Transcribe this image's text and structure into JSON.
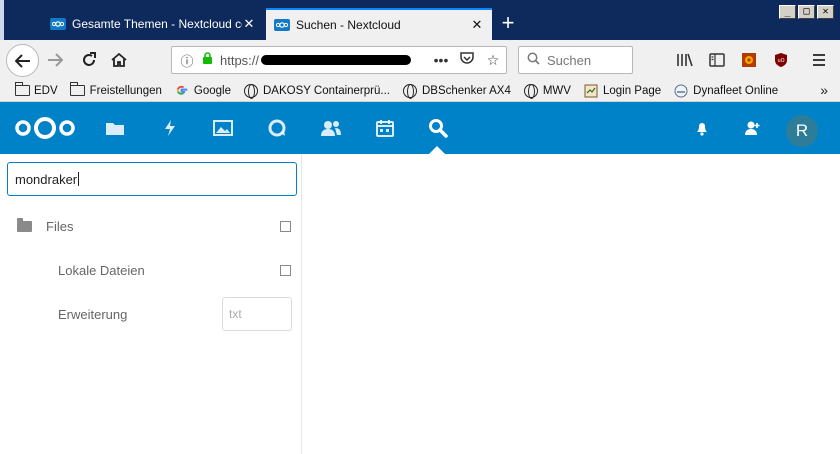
{
  "browser": {
    "tabs": [
      {
        "title": "Gesamte Themen - Nextcloud com",
        "active": false
      },
      {
        "title": "Suchen - Nextcloud",
        "active": true
      }
    ],
    "new_tab_glyph": "+",
    "close_glyph": "✕",
    "window_controls": [
      "_",
      "□",
      "✕"
    ],
    "url_prefix": "https://",
    "search_placeholder": "Suchen",
    "bookmarks": [
      {
        "label": "EDV",
        "icon": "folder-icon"
      },
      {
        "label": "Freistellungen",
        "icon": "folder-icon"
      },
      {
        "label": "Google",
        "icon": "google-icon"
      },
      {
        "label": "DAKOSY Containerprü...",
        "icon": "globe-icon"
      },
      {
        "label": "DBSchenker AX4",
        "icon": "globe-icon"
      },
      {
        "label": "MWV",
        "icon": "globe-icon"
      },
      {
        "label": "Login Page",
        "icon": "page-icon"
      },
      {
        "label": "Dynafleet Online",
        "icon": "dynafleet-icon"
      }
    ],
    "more_glyph": "»"
  },
  "nextcloud": {
    "accent": "#0082c9",
    "apps": [
      "folder-icon",
      "activity-icon",
      "gallery-icon",
      "talk-icon",
      "contacts-icon",
      "calendar-icon",
      "search-icon"
    ],
    "right_icons": [
      "notifications-icon",
      "contacts-menu-icon"
    ],
    "avatar_letter": "R"
  },
  "sidebar": {
    "search_value": "mondraker",
    "filters": [
      {
        "label": "Files"
      },
      {
        "label": "Lokale Dateien"
      },
      {
        "label": "Erweiterung",
        "input_placeholder": "txt"
      }
    ]
  }
}
